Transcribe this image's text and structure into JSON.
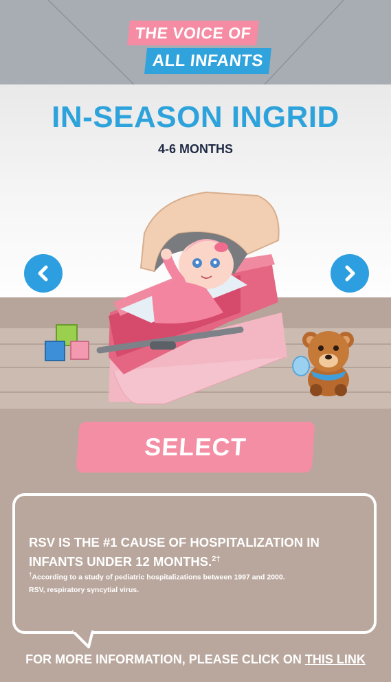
{
  "header": {
    "logo_line1": "THE VOICE OF",
    "logo_line2": "ALL INFANTS"
  },
  "character": {
    "name": "IN-SEASON INGRID",
    "age": "4-6 MONTHS"
  },
  "navigation": {
    "prev_icon": "chevron-left-icon",
    "next_icon": "chevron-right-icon"
  },
  "select_label": "SELECT",
  "info": {
    "main_text": "RSV IS THE #1 CAUSE OF HOSPITALIZATION IN INFANTS UNDER 12 MONTHS.",
    "main_superscript": "2†",
    "footnote_mark": "†",
    "footnote_1": "According to a study of pediatric hospitalizations between 1997 and 2000.",
    "footnote_2": "RSV, respiratory syncytial virus."
  },
  "more_info": {
    "text": "FOR MORE INFORMATION, PLEASE CLICK ON ",
    "link": "THIS LINK"
  },
  "colors": {
    "primary_blue": "#2ea3db",
    "accent_pink": "#f48ea4",
    "header_gray": "#a8acb3",
    "floor_taupe": "#b9a79d"
  }
}
